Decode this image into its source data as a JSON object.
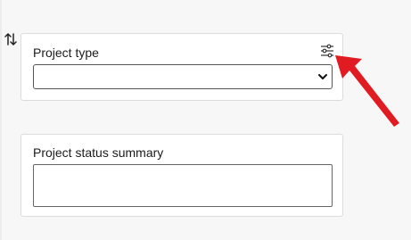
{
  "fields": {
    "project_type": {
      "label": "Project type",
      "selected_value": "",
      "settings_icon": "filter-settings-icon"
    },
    "project_status_summary": {
      "label": "Project status summary",
      "value": ""
    }
  },
  "icons": {
    "sort": "sort-arrows-icon",
    "dropdown": "chevron-down-icon"
  },
  "colors": {
    "background": "#f7f7f7",
    "card": "#ffffff",
    "annotation_arrow": "#e11b22"
  }
}
